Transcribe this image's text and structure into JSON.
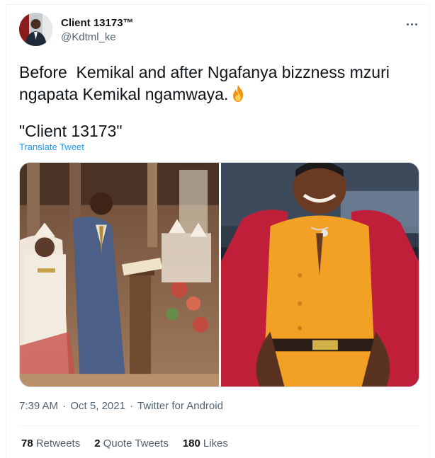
{
  "tweet": {
    "author": {
      "display_name": "Client 13173™",
      "handle": "@Kdtml_ke"
    },
    "text": "Before  Kemikal and after Ngafanya bizzness mzuri ngapata Kemikal ngamwaya.",
    "text_emoji_icon": "fire-emoji",
    "quote": "\"Client 13173\"",
    "translate_label": "Translate Tweet",
    "media": [
      {
        "description_icon": "photo-before"
      },
      {
        "description_icon": "photo-after"
      }
    ],
    "meta": {
      "time": "7:39 AM",
      "separator": "·",
      "date": "Oct 5, 2021",
      "source": "Twitter for Android"
    },
    "stats": {
      "retweets_count": "78",
      "retweets_label": "Retweets",
      "quotes_count": "2",
      "quotes_label": "Quote Tweets",
      "likes_count": "180",
      "likes_label": "Likes"
    }
  },
  "colors": {
    "text": "#0f1419",
    "secondary": "#536471",
    "link": "#1d9bf0",
    "border": "#eff3f4"
  }
}
